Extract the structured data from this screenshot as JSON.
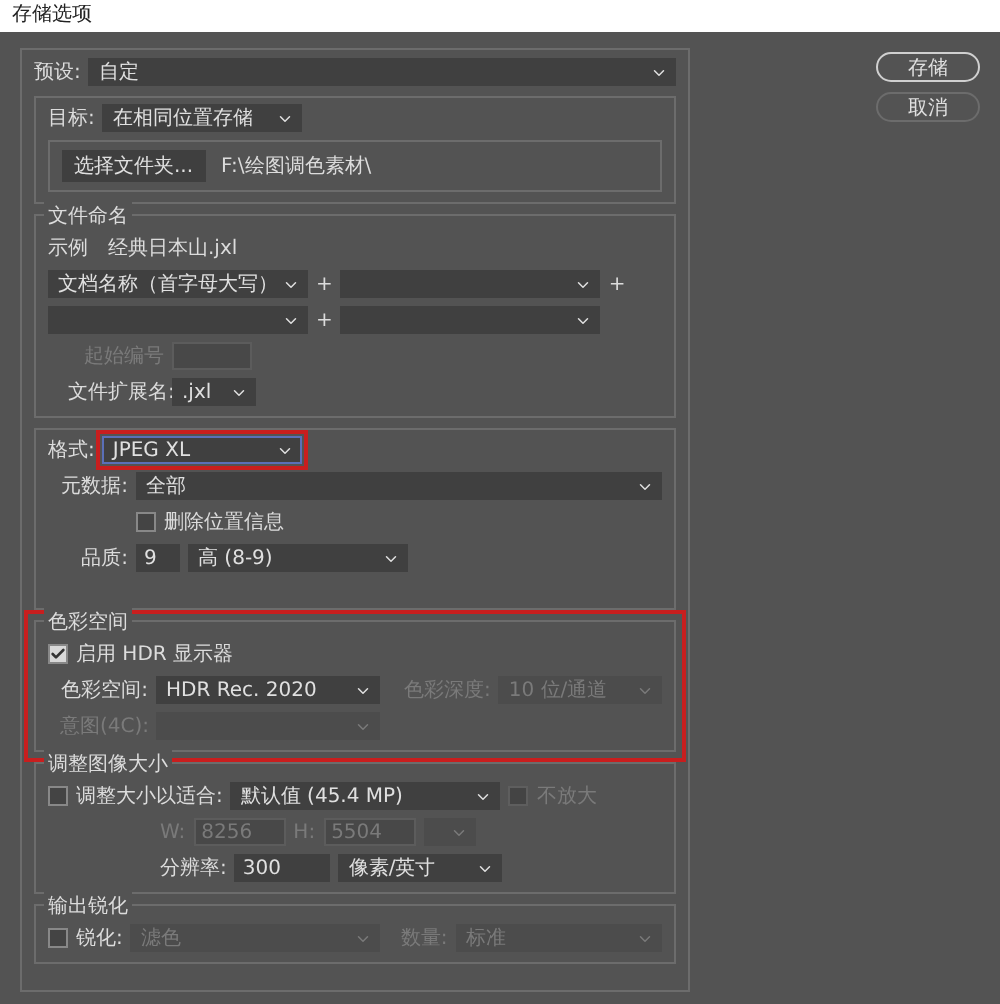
{
  "window": {
    "title": "存储选项"
  },
  "preset": {
    "label": "预设:",
    "value": "自定"
  },
  "destination": {
    "label": "目标:",
    "value": "在相同位置存储",
    "folder_button": "选择文件夹...",
    "path": "F:\\绘图调色素材\\"
  },
  "file_naming": {
    "title": "文件命名",
    "example_label": "示例",
    "example": "经典日本山.jxl",
    "rows": [
      {
        "values": [
          "文档名称（首字母大写）"
        ],
        "plus": [
          "+",
          "+"
        ]
      },
      {
        "plus": [
          "+"
        ]
      }
    ],
    "start_number": {
      "label": "起始编号",
      "disabled": true
    },
    "extension": {
      "label": "文件扩展名:",
      "value": ".jxl"
    }
  },
  "format": {
    "label": "格式:",
    "value": "JPEG XL",
    "highlighted": true,
    "metadata": {
      "label": "元数据:",
      "value": "全部"
    },
    "remove_location": {
      "label": "删除位置信息",
      "checked": false
    },
    "quality": {
      "label": "品质:",
      "value": "9",
      "setting": "高 (8-9)"
    }
  },
  "color_space": {
    "title": "色彩空间",
    "highlighted": true,
    "hdr": {
      "label": "启用 HDR 显示器",
      "checked": true
    },
    "space": {
      "label": "色彩空间:",
      "value": "HDR Rec. 2020",
      "disabled": false
    },
    "depth": {
      "label": "色彩深度:",
      "value": "10 位/通道",
      "disabled": true
    },
    "intent": {
      "label": "意图(4C):",
      "disabled": true
    }
  },
  "resize": {
    "title": "调整图像大小",
    "fit": {
      "label": "调整大小以适合:",
      "checked": false
    },
    "fit_value": "默认值 (45.4 MP)",
    "no_enlarge": {
      "label": "不放大",
      "checked": false,
      "disabled": true
    },
    "width": {
      "label": "W:",
      "value": "8256",
      "disabled": true
    },
    "height": {
      "label": "H:",
      "value": "5504",
      "disabled": true
    },
    "resolution": {
      "label": "分辨率:",
      "value": "300",
      "unit": "像素/英寸"
    }
  },
  "sharpen": {
    "title": "输出锐化",
    "enable": {
      "label": "锐化:",
      "checked": false
    },
    "target": {
      "value": "滤色",
      "disabled": true
    },
    "amount": {
      "label": "数量:",
      "value": "标准",
      "disabled": true
    }
  },
  "buttons": [
    {
      "label": "存储",
      "default": true
    },
    {
      "label": "取消",
      "default": false
    }
  ]
}
